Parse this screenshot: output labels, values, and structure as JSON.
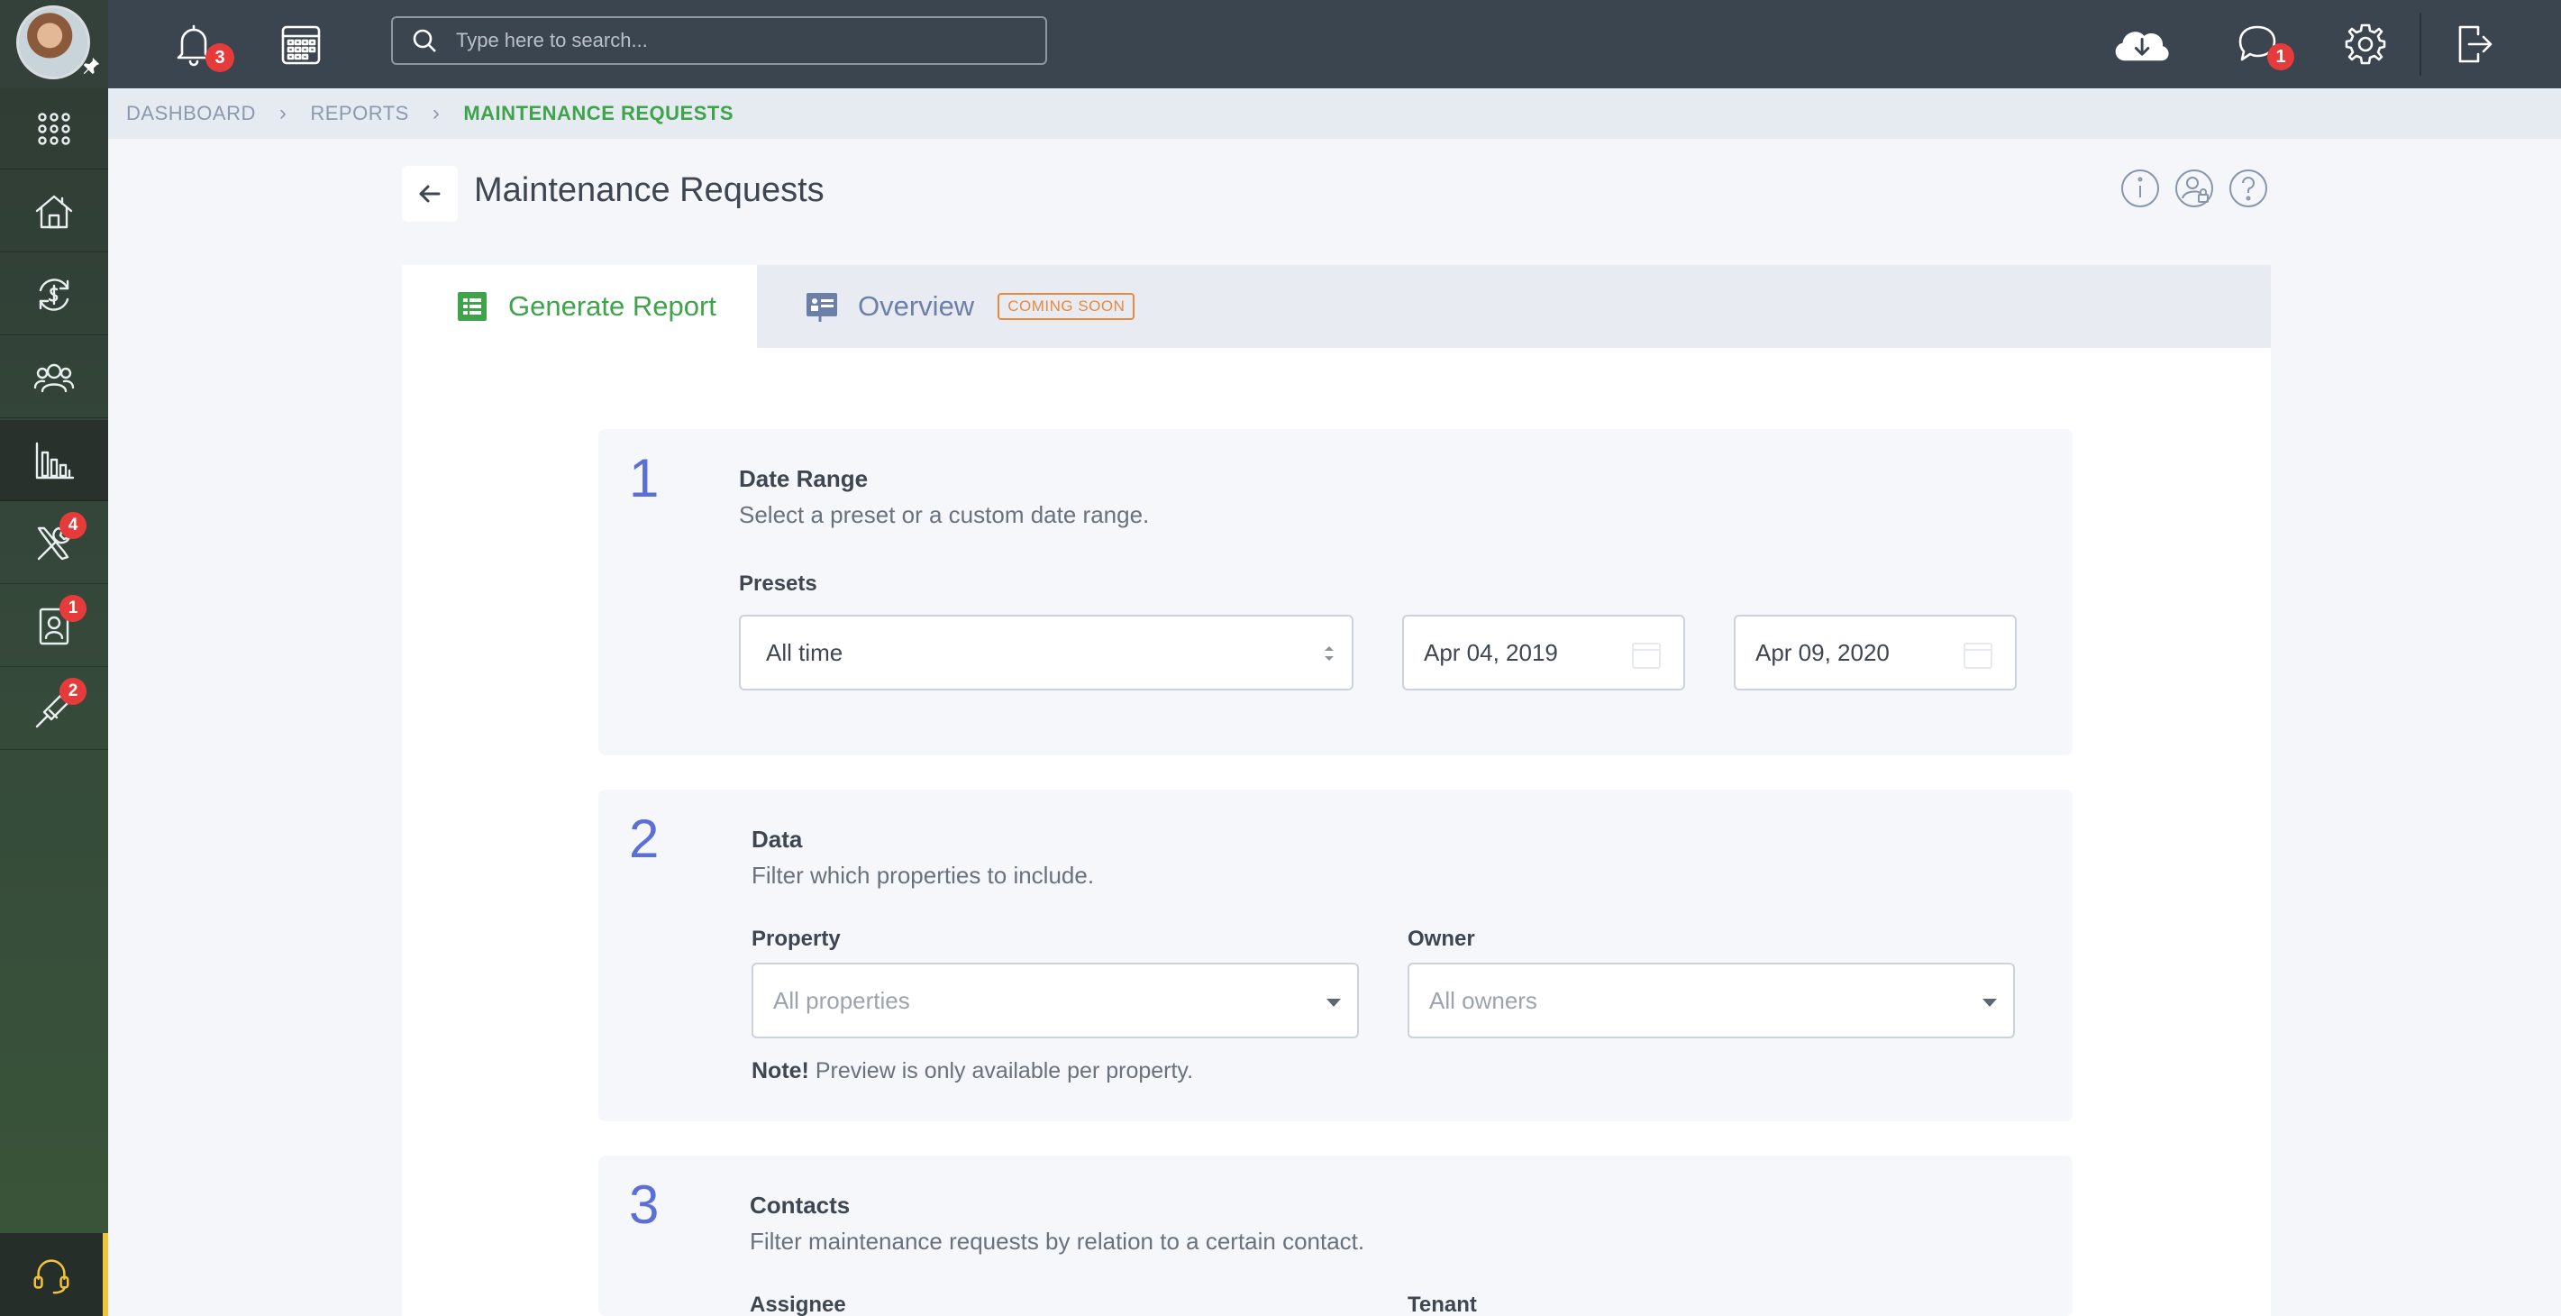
{
  "topbar": {
    "notifications_count": "3",
    "search_placeholder": "Type here to search...",
    "messages_count": "1"
  },
  "sidebar": {
    "badges": {
      "maintenance": "4",
      "tenants": "1",
      "tasks": "2"
    }
  },
  "breadcrumb": [
    "DASHBOARD",
    "REPORTS",
    "MAINTENANCE REQUESTS"
  ],
  "page": {
    "title": "Maintenance Requests"
  },
  "tabs": [
    {
      "label": "Generate Report",
      "active": true
    },
    {
      "label": "Overview",
      "badge": "COMING SOON",
      "active": false
    }
  ],
  "sections": {
    "date_range": {
      "number": "1",
      "title": "Date Range",
      "description": "Select a preset or a custom date range.",
      "presets_label": "Presets",
      "preset_value": "All time",
      "start_date": "Apr 04, 2019",
      "end_date": "Apr 09, 2020"
    },
    "data": {
      "number": "2",
      "title": "Data",
      "description": "Filter which properties to include.",
      "property_label": "Property",
      "property_placeholder": "All properties",
      "owner_label": "Owner",
      "owner_placeholder": "All owners",
      "note_bold": "Note!",
      "note_text": " Preview is only available per property."
    },
    "contacts": {
      "number": "3",
      "title": "Contacts",
      "description": "Filter maintenance requests by relation to a certain contact.",
      "assignee_label": "Assignee",
      "tenant_label": "Tenant"
    }
  },
  "colors": {
    "accent_green": "#3ea34a",
    "step_blue": "#5b6fd6",
    "badge_red": "#e53b3b",
    "coming_soon_orange": "#e8893c"
  }
}
